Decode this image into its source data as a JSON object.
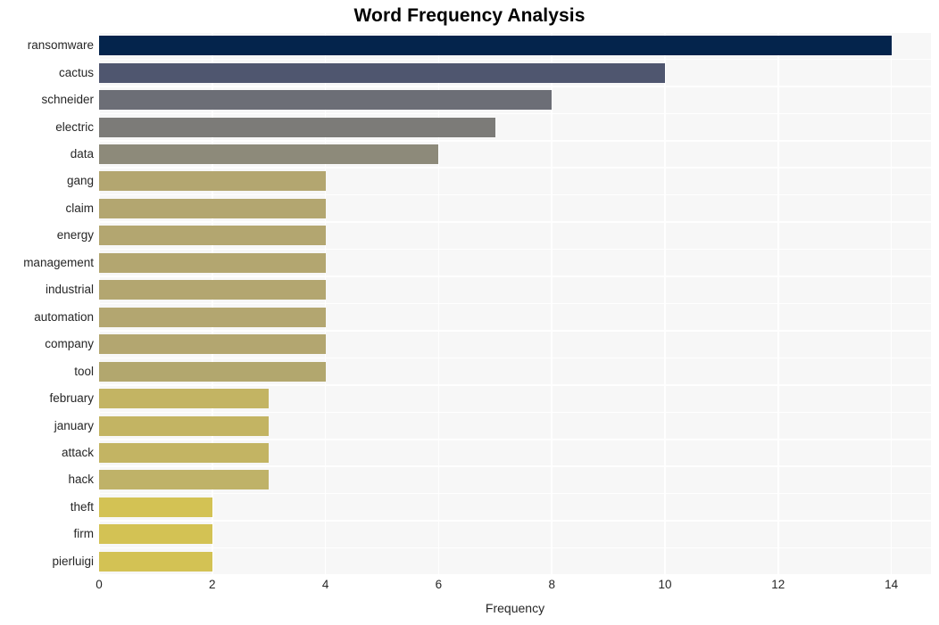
{
  "chart_data": {
    "type": "bar",
    "orientation": "horizontal",
    "title": "Word Frequency Analysis",
    "xlabel": "Frequency",
    "ylabel": "",
    "xlim": [
      0,
      14.7
    ],
    "ylim": [
      0,
      20
    ],
    "grid": true,
    "legend": null,
    "xticks": [
      0,
      2,
      4,
      6,
      8,
      10,
      12,
      14
    ],
    "xtick_labels": [
      "0",
      "2",
      "4",
      "6",
      "8",
      "10",
      "12",
      "14"
    ],
    "categories": [
      "ransomware",
      "cactus",
      "schneider",
      "electric",
      "data",
      "gang",
      "claim",
      "energy",
      "management",
      "industrial",
      "automation",
      "company",
      "tool",
      "february",
      "january",
      "attack",
      "hack",
      "theft",
      "firm",
      "pierluigi"
    ],
    "values": [
      14,
      10,
      8,
      7,
      6,
      4,
      4,
      4,
      4,
      4,
      4,
      4,
      4,
      3,
      3,
      3,
      3,
      2,
      2,
      2
    ],
    "bar_colors": [
      "#04244c",
      "#4f566f",
      "#6c6e76",
      "#7c7b78",
      "#8d8a7a",
      "#b3a670",
      "#b3a670",
      "#b3a670",
      "#b3a670",
      "#b3a670",
      "#b3a670",
      "#b3a670",
      "#b2a76e",
      "#c3b463",
      "#c3b463",
      "#c3b463",
      "#bfb268",
      "#d3c254",
      "#d3c254",
      "#d3c254"
    ],
    "plot_background": "#f7f7f7",
    "grid_color": "#ffffff",
    "figure_background": "#ffffff",
    "text_color": "#262626"
  }
}
